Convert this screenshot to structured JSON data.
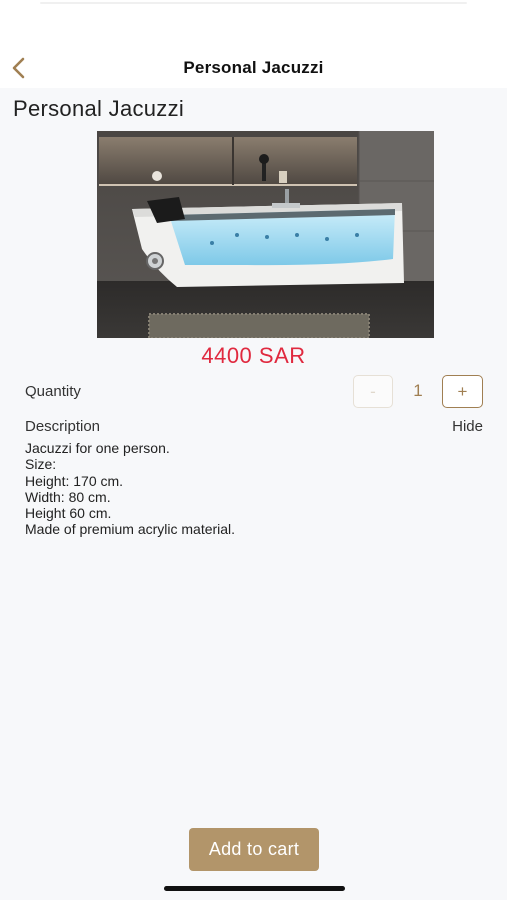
{
  "header": {
    "title": "Personal Jacuzzi",
    "back_icon": "chevron-left-icon"
  },
  "product": {
    "title": "Personal Jacuzzi",
    "image_alt": "white acrylic jacuzzi bathtub with glass front",
    "price": "4400 SAR",
    "price_color": "#e0293f"
  },
  "quantity": {
    "label": "Quantity",
    "minus_label": "-",
    "value": "1",
    "plus_label": "+"
  },
  "description": {
    "label": "Description",
    "toggle_label": "Hide",
    "lines": [
      "Jacuzzi for one person.",
      "Size:",
      "Height: 170 cm.",
      "Width: 80 cm.",
      "Height 60 cm.",
      "Made of premium acrylic material."
    ]
  },
  "cart": {
    "button_label": "Add to cart",
    "accent_color": "#b2956a"
  }
}
